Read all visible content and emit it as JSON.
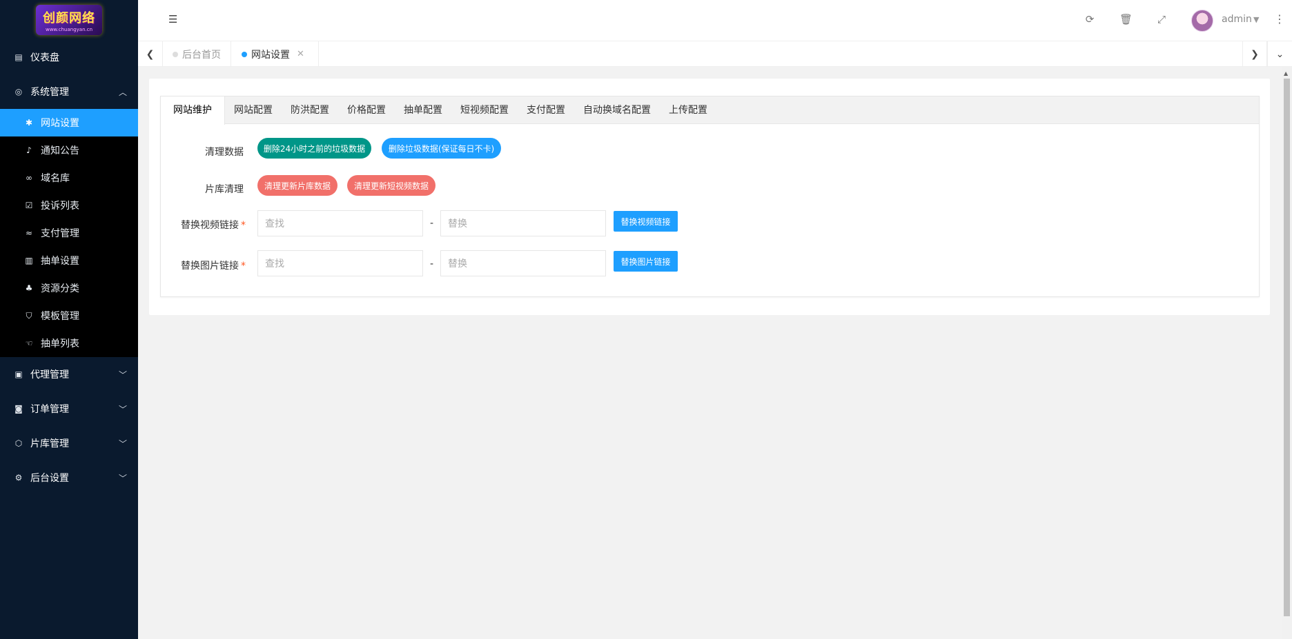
{
  "sidebar": {
    "logo": {
      "text": "创颜网络",
      "sub": "www.chuangyan.cn"
    },
    "items": [
      {
        "label": "仪表盘",
        "icon": "document-icon"
      },
      {
        "label": "系统管理",
        "icon": "target-icon"
      },
      {
        "label": "代理管理",
        "icon": "contact-card-icon"
      },
      {
        "label": "订单管理",
        "icon": "font-box-icon"
      },
      {
        "label": "片库管理",
        "icon": "hexagon-icon"
      },
      {
        "label": "后台设置",
        "icon": "gears-icon"
      }
    ],
    "system_sub": [
      {
        "label": "网站设置",
        "icon": "asterisk-icon"
      },
      {
        "label": "通知公告",
        "icon": "bell-icon"
      },
      {
        "label": "域名库",
        "icon": "link-icon"
      },
      {
        "label": "投诉列表",
        "icon": "checkbox-icon"
      },
      {
        "label": "支付管理",
        "icon": "wave-icon"
      },
      {
        "label": "抽单设置",
        "icon": "building-icon"
      },
      {
        "label": "资源分类",
        "icon": "leaf-icon"
      },
      {
        "label": "模板管理",
        "icon": "html5-icon"
      },
      {
        "label": "抽单列表",
        "icon": "hand-icon"
      }
    ]
  },
  "header": {
    "user": "admin"
  },
  "tabbar": {
    "home": "后台首页",
    "current": "网站设置"
  },
  "settings": {
    "tabs": [
      "网站维护",
      "网站配置",
      "防洪配置",
      "价格配置",
      "抽单配置",
      "短视频配置",
      "支付配置",
      "自动换域名配置",
      "上传配置"
    ],
    "clean_label": "清理数据",
    "clean_btn1": "删除24小时之前的垃圾数据",
    "clean_btn2": "删除垃圾数据(保证每日不卡)",
    "lib_label": "片库清理",
    "lib_btn1": "清理更新片库数据",
    "lib_btn2": "清理更新短视频数据",
    "video_label": "替换视频链接",
    "image_label": "替换图片链接",
    "find_placeholder": "查找",
    "replace_placeholder": "替换",
    "dash": "-",
    "video_btn": "替换视频链接",
    "image_btn": "替换图片链接"
  },
  "colors": {
    "sidebar_bg": "#0a1a2e",
    "active": "#1e9fff",
    "teal": "#009688",
    "red": "#f1706a"
  }
}
